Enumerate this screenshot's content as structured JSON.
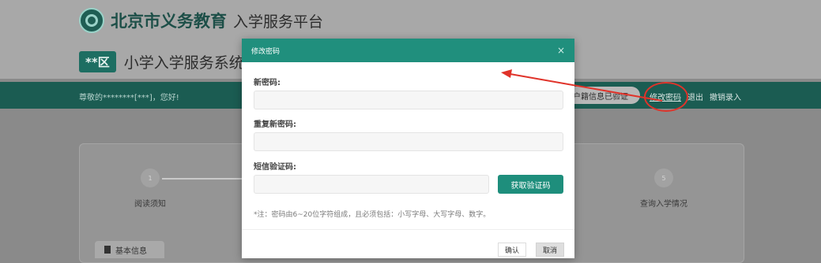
{
  "header": {
    "city_title": "北京市义务教育",
    "platform_title": "入学服务平台",
    "district_badge": "**区",
    "system_title": "小学入学服务系统"
  },
  "navbar": {
    "greeting": "尊敬的********[***]，您好!",
    "verify_status": "户籍信息已验证",
    "links": [
      "修改密码",
      "退出",
      "撤销录入"
    ]
  },
  "steps": [
    {
      "number": "1",
      "label": "阅读须知"
    },
    {
      "number": "5",
      "label": "查询入学情况"
    }
  ],
  "section_tab": "基本信息",
  "modal": {
    "title": "修改密码",
    "close_glyph": "×",
    "new_password_label": "新密码:",
    "new_password_value": "",
    "repeat_password_label": "重复新密码:",
    "repeat_password_value": "",
    "sms_label": "短信验证码:",
    "sms_value": "",
    "sms_button": "获取验证码",
    "note": "*注：密码由6~20位字符组成，且必须包括：小写字母、大写字母、数字。",
    "confirm": "确认",
    "cancel": "取消"
  },
  "colors": {
    "teal": "#208f7d",
    "annotation_red": "#e0332a"
  }
}
